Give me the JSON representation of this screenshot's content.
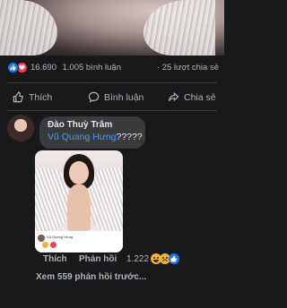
{
  "post": {
    "reactions_count": "16.690",
    "comments_count": "1.005 bình luận",
    "shares_count": "· 25 lượt chia sẻ"
  },
  "actions": {
    "like_label": "Thích",
    "comment_label": "Bình luận",
    "share_label": "Chia sẻ"
  },
  "comment": {
    "author": "Đào Thuỳ Trâm",
    "mention": "Vũ Quang Hưng",
    "text_suffix": "?????",
    "photo_caption_name": "Vũ Quang Hưng",
    "like_label": "Thích",
    "reply_label": "Phản hồi",
    "reactions_count": "1.222",
    "more_replies": "Xem 559 phản hồi trước..."
  },
  "colors": {
    "background": "#18191a",
    "like_blue": "#1877f2",
    "love_red": "#f33e58",
    "mention_blue": "#4599ff",
    "bubble": "#3a3b3c"
  },
  "icons": [
    "like-icon",
    "love-icon",
    "thumb-up-icon",
    "comment-icon",
    "share-icon",
    "haha-icon",
    "sad-icon"
  ]
}
